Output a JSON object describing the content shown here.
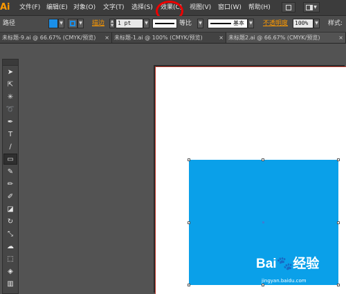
{
  "app": {
    "logo_text": "Ai"
  },
  "menu": {
    "items": [
      "文件(F)",
      "编辑(E)",
      "对象(O)",
      "文字(T)",
      "选择(S)",
      "效果(C)",
      "视图(V)",
      "窗口(W)",
      "帮助(H)"
    ]
  },
  "control_bar": {
    "object_type": "路径",
    "fill_color": "#1a8fe8",
    "stroke_label": "描边",
    "stroke_weight": "1 pt",
    "profile_label": "等比",
    "brush_label": "基本",
    "opacity_label": "不透明度",
    "opacity_value": "100%",
    "style_label": "样式"
  },
  "doc_tabs": [
    {
      "label": "未标题-9.ai @ 66.67% (CMYK/预览)",
      "active": false
    },
    {
      "label": "未标题-1.ai @ 100% (CMYK/预览)",
      "active": false
    },
    {
      "label": "未标题2.ai @ 66.67% (CMYK/预览)",
      "active": true
    }
  ],
  "tab_close_glyph": "×",
  "tools": [
    {
      "name": "selection-tool-icon",
      "glyph": "➤"
    },
    {
      "name": "direct-selection-tool-icon",
      "glyph": "⇱"
    },
    {
      "name": "magic-wand-tool-icon",
      "glyph": "✳"
    },
    {
      "name": "lasso-tool-icon",
      "glyph": "➰"
    },
    {
      "name": "pen-tool-icon",
      "glyph": "✒"
    },
    {
      "name": "type-tool-icon",
      "glyph": "T"
    },
    {
      "name": "line-tool-icon",
      "glyph": "∕"
    },
    {
      "name": "rectangle-tool-icon",
      "glyph": "▭"
    },
    {
      "name": "paintbrush-tool-icon",
      "glyph": "✎"
    },
    {
      "name": "pencil-tool-icon",
      "glyph": "✏"
    },
    {
      "name": "blob-brush-tool-icon",
      "glyph": "✐"
    },
    {
      "name": "eraser-tool-icon",
      "glyph": "◪"
    },
    {
      "name": "rotate-tool-icon",
      "glyph": "↻"
    },
    {
      "name": "scale-tool-icon",
      "glyph": "⤡"
    },
    {
      "name": "warp-tool-icon",
      "glyph": "☁"
    },
    {
      "name": "free-transform-tool-icon",
      "glyph": "⬚"
    },
    {
      "name": "shape-builder-tool-icon",
      "glyph": "◈"
    },
    {
      "name": "graph-tool-icon",
      "glyph": "▥"
    }
  ],
  "active_tool_index": 7,
  "canvas": {
    "shape_color": "#0aa0e9"
  },
  "watermark": {
    "brand": "Bai🐾经验",
    "url": "jingyan.baidu.com"
  },
  "colors": {
    "highlight_circle": "#e00000",
    "accent_orange": "#ff9a00"
  }
}
